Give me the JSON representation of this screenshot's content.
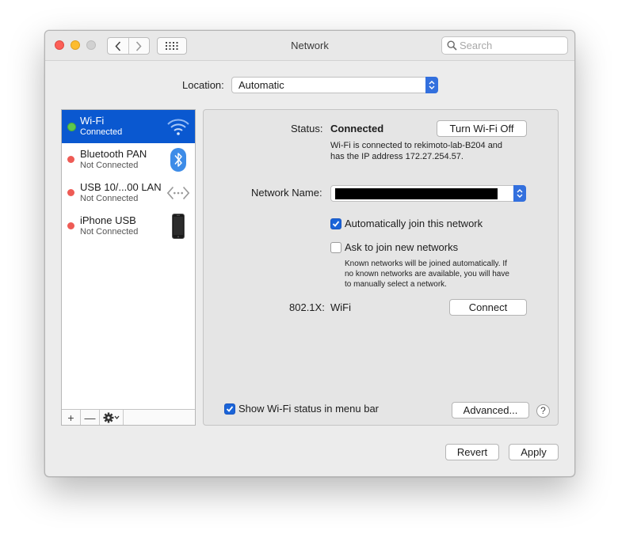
{
  "window": {
    "title": "Network"
  },
  "toolbar": {
    "search_placeholder": "Search"
  },
  "location": {
    "label": "Location:",
    "value": "Automatic"
  },
  "sidebar": {
    "items": [
      {
        "name": "Wi-Fi",
        "status": "Connected",
        "icon": "wifi-icon",
        "dot": "green"
      },
      {
        "name": "Bluetooth PAN",
        "status": "Not Connected",
        "icon": "bluetooth-icon",
        "dot": "red"
      },
      {
        "name": "USB 10/...00 LAN",
        "status": "Not Connected",
        "icon": "ethernet-icon",
        "dot": "red"
      },
      {
        "name": "iPhone USB",
        "status": "Not Connected",
        "icon": "iphone-icon",
        "dot": "red"
      }
    ],
    "add_label": "+",
    "remove_label": "—"
  },
  "detail": {
    "status_label": "Status:",
    "status_value": "Connected",
    "turn_off_label": "Turn Wi-Fi Off",
    "status_desc_line1": "Wi-Fi is connected to rekimoto-lab-B204 and",
    "status_desc_line2": "has the IP address 172.27.254.57.",
    "network_name_label": "Network Name:",
    "auto_join_label": "Automatically join this network",
    "auto_join_checked": true,
    "ask_join_label": "Ask to join new networks",
    "ask_join_checked": false,
    "ask_desc_line1": "Known networks will be joined automatically. If",
    "ask_desc_line2": "no known networks are available, you will have",
    "ask_desc_line3": "to manually select a network.",
    "dot1x_label": "802.1X:",
    "dot1x_value": "WiFi",
    "connect_label": "Connect",
    "show_status_label": "Show Wi-Fi status in menu bar",
    "show_status_checked": true,
    "advanced_label": "Advanced...",
    "help_label": "?"
  },
  "footer": {
    "revert_label": "Revert",
    "apply_label": "Apply"
  },
  "colors": {
    "accent": "#0a58d0",
    "connected": "#5ec84e",
    "not_connected": "#ee5b55"
  }
}
